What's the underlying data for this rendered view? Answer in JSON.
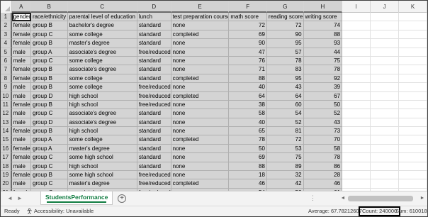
{
  "columns": [
    "A",
    "B",
    "C",
    "D",
    "E",
    "F",
    "G",
    "H",
    "I",
    "J",
    "K"
  ],
  "rows": [
    [
      "gender",
      "race/ethnicity",
      "parental level of education",
      "lunch",
      "test preparation course",
      "math score",
      "reading score",
      "writing score"
    ],
    [
      "female",
      "group B",
      "bachelor's degree",
      "standard",
      "none",
      "72",
      "72",
      "74"
    ],
    [
      "female",
      "group C",
      "some college",
      "standard",
      "completed",
      "69",
      "90",
      "88"
    ],
    [
      "female",
      "group B",
      "master's degree",
      "standard",
      "none",
      "90",
      "95",
      "93"
    ],
    [
      "male",
      "group A",
      "associate's degree",
      "free/reduced",
      "none",
      "47",
      "57",
      "44"
    ],
    [
      "male",
      "group C",
      "some college",
      "standard",
      "none",
      "76",
      "78",
      "75"
    ],
    [
      "female",
      "group B",
      "associate's degree",
      "standard",
      "none",
      "71",
      "83",
      "78"
    ],
    [
      "female",
      "group B",
      "some college",
      "standard",
      "completed",
      "88",
      "95",
      "92"
    ],
    [
      "male",
      "group B",
      "some college",
      "free/reduced",
      "none",
      "40",
      "43",
      "39"
    ],
    [
      "male",
      "group D",
      "high school",
      "free/reduced",
      "completed",
      "64",
      "64",
      "67"
    ],
    [
      "female",
      "group B",
      "high school",
      "free/reduced",
      "none",
      "38",
      "60",
      "50"
    ],
    [
      "male",
      "group C",
      "associate's degree",
      "standard",
      "none",
      "58",
      "54",
      "52"
    ],
    [
      "male",
      "group D",
      "associate's degree",
      "standard",
      "none",
      "40",
      "52",
      "43"
    ],
    [
      "female",
      "group B",
      "high school",
      "standard",
      "none",
      "65",
      "81",
      "73"
    ],
    [
      "male",
      "group A",
      "some college",
      "standard",
      "completed",
      "78",
      "72",
      "70"
    ],
    [
      "female",
      "group A",
      "master's degree",
      "standard",
      "none",
      "50",
      "53",
      "58"
    ],
    [
      "female",
      "group C",
      "some high school",
      "standard",
      "none",
      "69",
      "75",
      "78"
    ],
    [
      "male",
      "group C",
      "high school",
      "standard",
      "none",
      "88",
      "89",
      "86"
    ],
    [
      "female",
      "group B",
      "some high school",
      "free/reduced",
      "none",
      "18",
      "32",
      "28"
    ],
    [
      "male",
      "group C",
      "master's degree",
      "free/reduced",
      "completed",
      "46",
      "42",
      "46"
    ],
    [
      "female",
      "group C",
      "associate's degree",
      "free/reduced",
      "none",
      "54",
      "58",
      "61"
    ],
    [
      "male",
      "group D",
      "high school",
      "standard",
      "none",
      "66",
      "69",
      "63"
    ]
  ],
  "sheet_tab": "StudentsPerformance",
  "add_sheet_symbol": "+",
  "tab_dots": "⋮",
  "status": {
    "ready": "Ready",
    "accessibility": "Accessibility: Unavailable",
    "average": "Average: 67.78212607",
    "count": "Count: 240000",
    "sum": "Sum: 6100188"
  },
  "icons": {
    "nav_prev": "◄",
    "nav_next": "►",
    "scroll_left": "◄",
    "scroll_right": "►"
  },
  "colors": {
    "selection_fill": "#d4d4d4",
    "accent": "#107c41"
  }
}
